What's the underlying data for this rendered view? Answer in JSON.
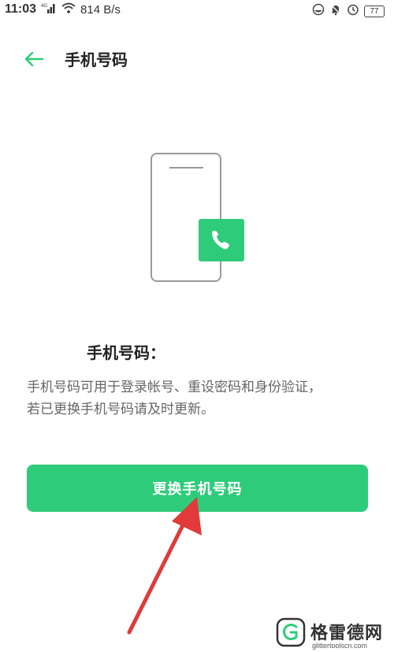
{
  "status_bar": {
    "time": "11:03",
    "network_speed": "814 B/s",
    "battery": "77",
    "icons": [
      "signal-icon",
      "wifi-icon",
      "vpn-icon",
      "bell-icon",
      "alarm-icon",
      "battery-icon"
    ]
  },
  "header": {
    "title": "手机号码",
    "back_icon": "back-arrow-icon"
  },
  "illustration": {
    "icon": "phone-call-icon"
  },
  "info": {
    "title": "手机号码：",
    "description_line1": "手机号码可用于登录帐号、重设密码和身份验证，",
    "description_line2": "若已更换手机号码请及时更新。"
  },
  "actions": {
    "change_number_label": "更换手机号码"
  },
  "watermark": {
    "name": "格雷德网",
    "domain": "glittertoolscn.com"
  },
  "colors": {
    "accent": "#2ecc7a",
    "annotation_arrow": "#e03a3a",
    "text_primary": "#222222",
    "text_secondary": "#666666"
  }
}
